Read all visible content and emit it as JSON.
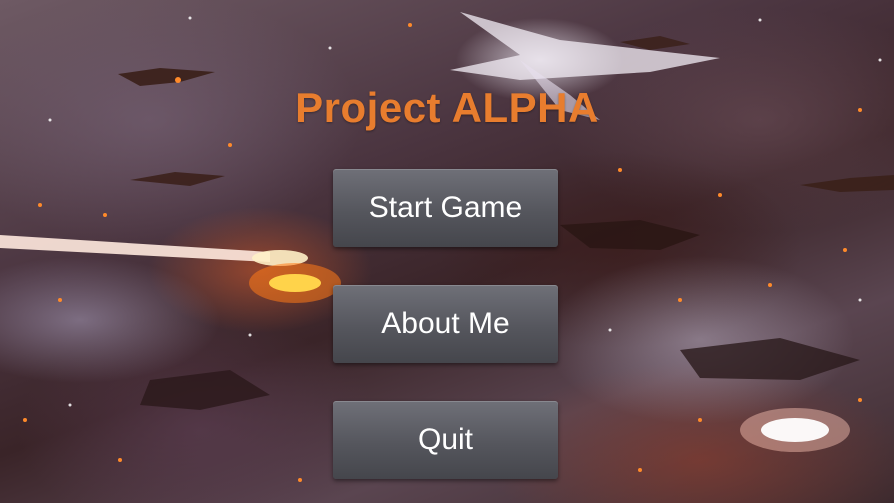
{
  "game": {
    "title": "Project ALPHA"
  },
  "menu": {
    "start_label": "Start Game",
    "about_label": "About Me",
    "quit_label": "Quit"
  },
  "colors": {
    "title": "#e87d2e",
    "button_face": "#55565d",
    "button_text": "#ffffff"
  }
}
